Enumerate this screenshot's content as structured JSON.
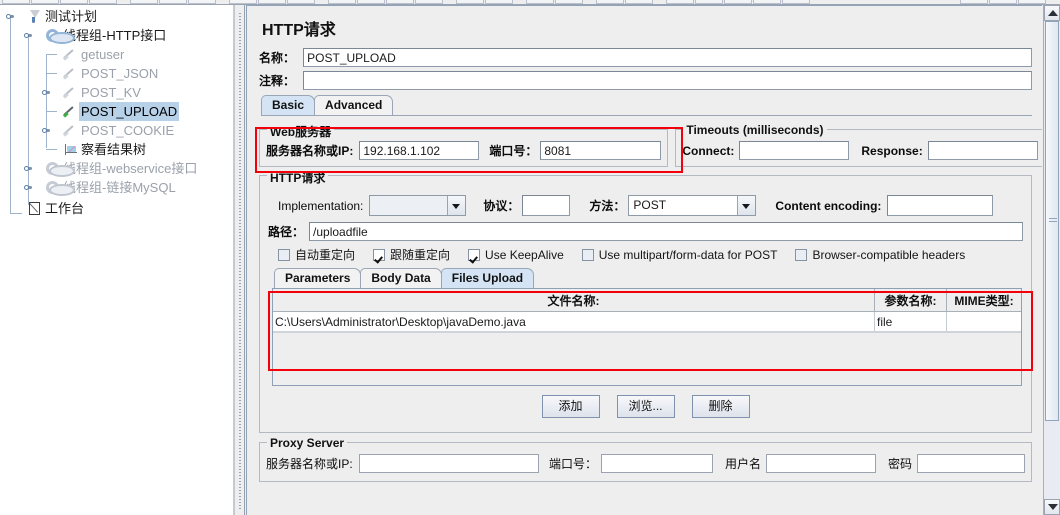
{
  "window": {
    "scrollbar_thumb_label": "vertical-scrollbar"
  },
  "tree": {
    "nodes": [
      {
        "label": "测试计划",
        "icon": "test-plan-icon",
        "state": "normal",
        "depth": 0
      },
      {
        "label": "线程组-HTTP接口",
        "icon": "thread-group-icon",
        "state": "normal",
        "depth": 1
      },
      {
        "label": "getuser",
        "icon": "http-sampler-icon",
        "state": "disabled",
        "depth": 2
      },
      {
        "label": "POST_JSON",
        "icon": "http-sampler-icon",
        "state": "disabled",
        "depth": 2
      },
      {
        "label": "POST_KV",
        "icon": "http-sampler-icon",
        "state": "disabled",
        "depth": 2
      },
      {
        "label": "POST_UPLOAD",
        "icon": "http-sampler-icon",
        "state": "selected",
        "depth": 2
      },
      {
        "label": "POST_COOKIE",
        "icon": "http-sampler-icon",
        "state": "disabled",
        "depth": 2
      },
      {
        "label": "察看结果树",
        "icon": "view-results-tree-icon",
        "state": "normal",
        "depth": 2
      },
      {
        "label": "线程组-webservice接口",
        "icon": "thread-group-icon",
        "state": "disabled",
        "depth": 1
      },
      {
        "label": "线程组-链接MySQL",
        "icon": "thread-group-icon",
        "state": "disabled",
        "depth": 1
      },
      {
        "label": "工作台",
        "icon": "workbench-icon",
        "state": "normal",
        "depth": 0
      }
    ]
  },
  "main": {
    "title": "HTTP请求",
    "name_label": "名称：",
    "name_value": "POST_UPLOAD",
    "comment_label": "注释：",
    "comment_value": "",
    "tabs": [
      {
        "label": "Basic",
        "selected": true
      },
      {
        "label": "Advanced",
        "selected": false
      }
    ],
    "web_server": {
      "group_title": "Web服务器",
      "server_label": "服务器名称或IP:",
      "server_value": "192.168.1.102",
      "port_label": "端口号：",
      "port_value": "8081"
    },
    "timeouts": {
      "group_title": "Timeouts (milliseconds)",
      "connect_label": "Connect:",
      "connect_value": "",
      "response_label": "Response:",
      "response_value": ""
    },
    "http_request": {
      "group_title": "HTTP请求",
      "implementation_label": "Implementation:",
      "implementation_value": "",
      "protocol_label": "协议：",
      "protocol_value": "",
      "method_label": "方法：",
      "method_value": "POST",
      "content_encoding_label": "Content encoding:",
      "content_encoding_value": "",
      "path_label": "路径：",
      "path_value": "/uploadfile",
      "checkboxes": [
        {
          "label": "自动重定向",
          "checked": false
        },
        {
          "label": "跟随重定向",
          "checked": true
        },
        {
          "label": "Use KeepAlive",
          "checked": true
        },
        {
          "label": "Use multipart/form-data for POST",
          "checked": false
        },
        {
          "label": "Browser-compatible headers",
          "checked": false
        }
      ],
      "data_tabs": [
        {
          "label": "Parameters",
          "selected": false
        },
        {
          "label": "Body Data",
          "selected": false
        },
        {
          "label": "Files Upload",
          "selected": true
        }
      ],
      "files_table": {
        "columns": [
          "文件名称:",
          "参数名称:",
          "MIME类型:"
        ],
        "rows": [
          [
            "C:\\Users\\Administrator\\Desktop\\javaDemo.java",
            "file",
            ""
          ]
        ]
      },
      "buttons": [
        {
          "label": "添加"
        },
        {
          "label": "浏览..."
        },
        {
          "label": "删除"
        }
      ]
    },
    "proxy_server": {
      "group_title": "Proxy Server",
      "server_label": "服务器名称或IP:",
      "server_value": "",
      "port_label": "端口号：",
      "port_value": "",
      "username_label": "用户名",
      "username_value": "",
      "password_label": "密码",
      "password_value": ""
    }
  },
  "colors": {
    "highlight": "#f4000a",
    "selected_tab_bg": "#d4e4f5",
    "tree_selection_bg": "#b6d1e8",
    "panel_bg": "#eeeeee"
  }
}
